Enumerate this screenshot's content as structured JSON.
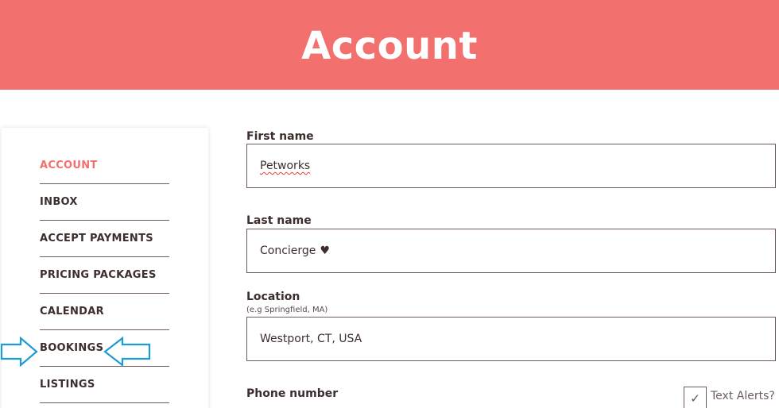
{
  "header": {
    "title": "Account"
  },
  "sidebar": {
    "items": [
      {
        "label": "ACCOUNT",
        "active": true
      },
      {
        "label": "INBOX",
        "active": false
      },
      {
        "label": "ACCEPT PAYMENTS",
        "active": false
      },
      {
        "label": "PRICING PACKAGES",
        "active": false
      },
      {
        "label": "CALENDAR",
        "active": false
      },
      {
        "label": "BOOKINGS",
        "active": false
      },
      {
        "label": "LISTINGS",
        "active": false
      }
    ]
  },
  "form": {
    "first_name": {
      "label": "First name",
      "value": "Petworks"
    },
    "last_name": {
      "label": "Last name",
      "value": "Concierge",
      "suffix": "♥"
    },
    "location": {
      "label": "Location",
      "hint": "(e.g Springfield, MA)",
      "value": "Westport, CT, USA"
    },
    "phone": {
      "label": "Phone number"
    },
    "text_alerts": {
      "label": "Text Alerts?",
      "checked": true,
      "check_glyph": "✓"
    }
  },
  "colors": {
    "brand": "#f2706e",
    "text": "#3d2e2e",
    "annotation_arrow": "#1e9ad6"
  }
}
